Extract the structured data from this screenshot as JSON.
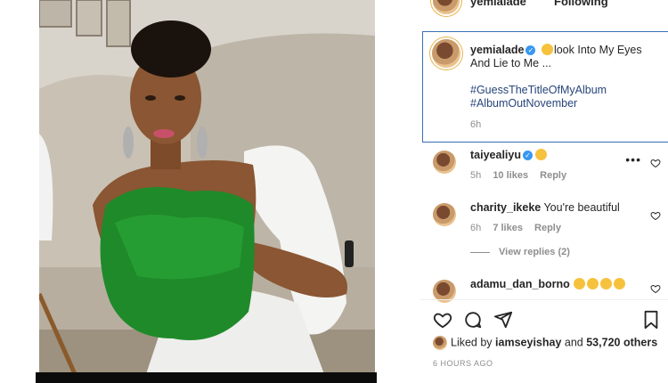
{
  "header": {
    "username": "yemialade",
    "follow_label": "Following"
  },
  "caption": {
    "username": "yemialade",
    "text": "look Into My Eyes And Lie to Me ...",
    "hashtags": [
      "#GuessTheTitleOfMyAlbum",
      "#AlbumOutNovember"
    ],
    "time": "6h"
  },
  "comments": [
    {
      "username": "taiyealiyu",
      "text": "",
      "time": "5h",
      "likes": "10 likes",
      "reply": "Reply"
    },
    {
      "username": "charity_ikeke",
      "text": "You're beautiful",
      "time": "6h",
      "likes": "7 likes",
      "reply": "Reply"
    },
    {
      "username": "adamu_dan_borno",
      "text": ""
    }
  ],
  "view_replies": "View replies (2)",
  "likes": {
    "prefix": "Liked by",
    "user": "iamseyishay",
    "and": "and",
    "count": "53,720 others"
  },
  "post_time": "6 HOURS AGO",
  "colors": {
    "accent": "#3897f0",
    "caption_border": "#3a6fb5",
    "hashtag": "#27457a",
    "muted": "#8e8e8e"
  }
}
